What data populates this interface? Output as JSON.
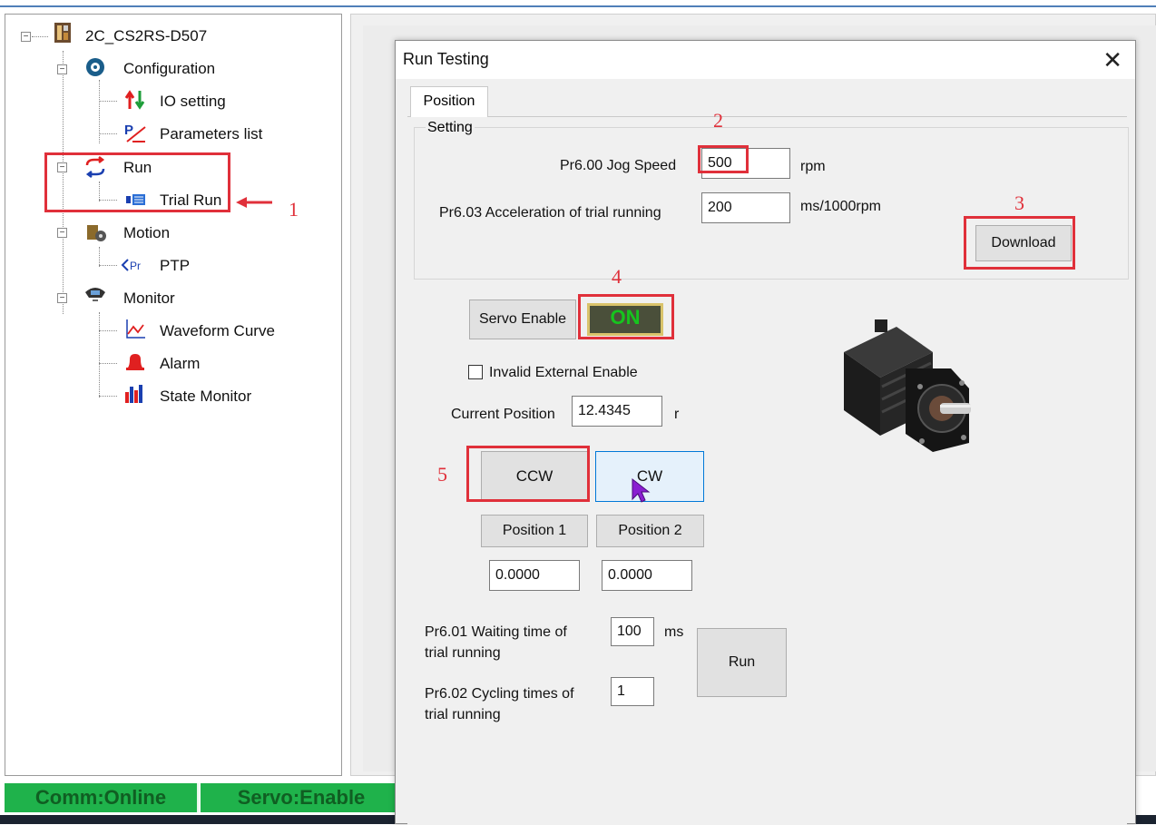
{
  "tree": {
    "root_label": "2C_CS2RS-D507",
    "items": [
      {
        "label": "Configuration",
        "icon": "gear-icon"
      },
      {
        "label": "IO setting",
        "icon": "io-arrows-icon"
      },
      {
        "label": "Parameters list",
        "icon": "parameters-icon"
      },
      {
        "label": "Run",
        "icon": "run-cycle-icon"
      },
      {
        "label": "Trial Run",
        "icon": "trial-run-icon"
      },
      {
        "label": "Motion",
        "icon": "motion-icon"
      },
      {
        "label": "PTP",
        "icon": "ptp-icon"
      },
      {
        "label": "Monitor",
        "icon": "monitor-icon"
      },
      {
        "label": "Waveform Curve",
        "icon": "waveform-icon"
      },
      {
        "label": "Alarm",
        "icon": "alarm-bell-icon"
      },
      {
        "label": "State Monitor",
        "icon": "bar-chart-icon"
      }
    ]
  },
  "status_bar": {
    "comm": "Comm:Online",
    "servo": "Servo:Enable",
    "color": "#1fb24b"
  },
  "dialog": {
    "title": "Run Testing",
    "tab_label": "Position",
    "setting_group": {
      "legend": "Setting",
      "jog_speed_label": "Pr6.00 Jog Speed",
      "jog_speed_value": "500",
      "jog_speed_unit": "rpm",
      "accel_label": "Pr6.03 Acceleration of trial running",
      "accel_value": "200",
      "accel_unit": "ms/1000rpm",
      "download_label": "Download"
    },
    "servo_enable_label": "Servo Enable",
    "servo_state": "ON",
    "invalid_external_enable_label": "Invalid External Enable",
    "current_position_label": "Current Position",
    "current_position_value": "12.4345",
    "current_position_unit": "r",
    "ccw_label": "CCW",
    "cw_label": "CW",
    "position1_label": "Position 1",
    "position2_label": "Position 2",
    "position1_value": "0.0000",
    "position2_value": "0.0000",
    "waiting_label_line1": "Pr6.01 Waiting time of",
    "waiting_label_line2": "trial running",
    "waiting_value": "100",
    "waiting_unit": "ms",
    "cycling_label_line1": "Pr6.02 Cycling times of",
    "cycling_label_line2": "trial running",
    "cycling_value": "1",
    "run_label": "Run"
  },
  "annotations": {
    "step1": "1",
    "step2": "2",
    "step3": "3",
    "step4": "4",
    "step5": "5",
    "highlight_color": "#e0303a"
  }
}
